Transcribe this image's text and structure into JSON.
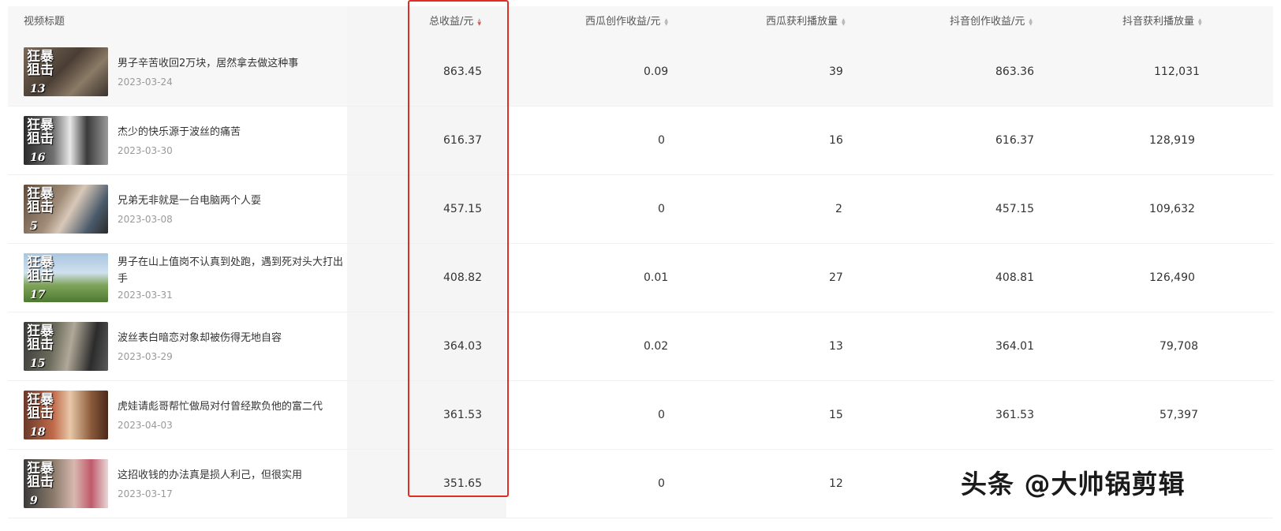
{
  "columns": {
    "title": "视频标题",
    "total_income": "总收益/元",
    "xigua_income": "西瓜创作收益/元",
    "xigua_plays": "西瓜获利播放量",
    "douyin_income": "抖音创作收益/元",
    "douyin_plays": "抖音获利播放量"
  },
  "sort": {
    "active_column": "total_income",
    "direction": "desc"
  },
  "rows": [
    {
      "thumb_text": "狂暴狙击",
      "episode": "13",
      "title": "男子辛苦收回2万块，居然拿去做这种事",
      "date": "2023-03-24",
      "total_income": "863.45",
      "xigua_income": "0.09",
      "xigua_plays": "39",
      "douyin_income": "863.36",
      "douyin_plays": "112,031"
    },
    {
      "thumb_text": "狂暴狙击",
      "episode": "16",
      "title": "杰少的快乐源于波丝的痛苦",
      "date": "2023-03-30",
      "total_income": "616.37",
      "xigua_income": "0",
      "xigua_plays": "16",
      "douyin_income": "616.37",
      "douyin_plays": "128,919"
    },
    {
      "thumb_text": "狂暴狙击",
      "episode": "5",
      "title": "兄弟无非就是一台电脑两个人耍",
      "date": "2023-03-08",
      "total_income": "457.15",
      "xigua_income": "0",
      "xigua_plays": "2",
      "douyin_income": "457.15",
      "douyin_plays": "109,632"
    },
    {
      "thumb_text": "狂暴狙击",
      "episode": "17",
      "title": "男子在山上值岗不认真到处跑，遇到死对头大打出手",
      "date": "2023-03-31",
      "total_income": "408.82",
      "xigua_income": "0.01",
      "xigua_plays": "27",
      "douyin_income": "408.81",
      "douyin_plays": "126,490"
    },
    {
      "thumb_text": "狂暴狙击",
      "episode": "15",
      "title": "波丝表白暗恋对象却被伤得无地自容",
      "date": "2023-03-29",
      "total_income": "364.03",
      "xigua_income": "0.02",
      "xigua_plays": "13",
      "douyin_income": "364.01",
      "douyin_plays": "79,708"
    },
    {
      "thumb_text": "狂暴狙击",
      "episode": "18",
      "title": "虎娃请彪哥帮忙做局对付曾经欺负他的富二代",
      "date": "2023-04-03",
      "total_income": "361.53",
      "xigua_income": "0",
      "xigua_plays": "15",
      "douyin_income": "361.53",
      "douyin_plays": "57,397"
    },
    {
      "thumb_text": "狂暴狙击",
      "episode": "9",
      "title": "这招收钱的办法真是损人利己，但很实用",
      "date": "2023-03-17",
      "total_income": "351.65",
      "xigua_income": "0",
      "xigua_plays": "12",
      "douyin_income": "",
      "douyin_plays": ""
    }
  ],
  "watermark": "头条 @大帅锅剪辑",
  "colors": {
    "highlight_box": "#e02e24",
    "sort_active": "#e0514e",
    "header_bg": "#f7f7f7"
  }
}
